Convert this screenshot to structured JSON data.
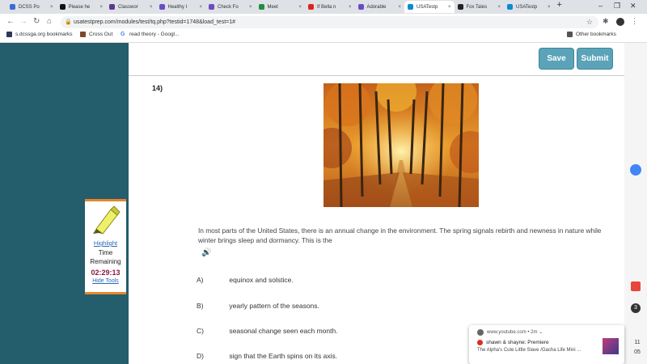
{
  "browser": {
    "tabs": [
      {
        "label": "DCSS Po",
        "color": "#3b6bd6"
      },
      {
        "label": "Please he",
        "color": "#111111"
      },
      {
        "label": "Classwor",
        "color": "#5b3a8c"
      },
      {
        "label": "Healthy I",
        "color": "#6b4cc2"
      },
      {
        "label": "Check Fo",
        "color": "#6b4cc2"
      },
      {
        "label": "Meet",
        "color": "#1e8e3e"
      },
      {
        "label": "If Bella n",
        "color": "#e02020"
      },
      {
        "label": "Adorable",
        "color": "#6b4cc2"
      },
      {
        "label": "USATestp",
        "color": "#0a8bd6"
      },
      {
        "label": "Fox Tales",
        "color": "#222222"
      },
      {
        "label": "USATestp",
        "color": "#0a8bd6"
      }
    ],
    "new_tab": "+",
    "url": "usatestprep.com/modules/test/tq.php?testid=1748&load_test=1#",
    "bookmarks": [
      {
        "label": "s.dcssga.org bookmarks",
        "color": "#2a3a5a"
      },
      {
        "label": "Cross Out",
        "color": "#7a4a2a"
      },
      {
        "label": "read theory - Googl...",
        "color": "#4285f4"
      }
    ],
    "other_bookmarks": "Other bookmarks"
  },
  "toolbar": {
    "save_label": "Save",
    "submit_label": "Submit"
  },
  "question": {
    "number": "14)",
    "text": "In most parts of the United States, there is an annual change in the environment. The spring signals rebirth and newness in nature while winter brings sleep and dormancy. This is the",
    "options": [
      {
        "letter": "A)",
        "text": "equinox and solstice."
      },
      {
        "letter": "B)",
        "text": "yearly pattern of the seasons."
      },
      {
        "letter": "C)",
        "text": "seasonal change seen each month."
      },
      {
        "letter": "D)",
        "text": "sign that the Earth spins on its axis."
      }
    ]
  },
  "tools": {
    "highlight_label": "Highlight",
    "time_label": "Time Remaining",
    "timer": "02:29:13",
    "hide_label": "Hide Tools"
  },
  "notification": {
    "source": "www.youtube.com",
    "age": "2m",
    "title": "shawn & shayne: Premiere",
    "body": "The Alpha's Cute Little Slave /Gacha Life Mini ..."
  },
  "clock": {
    "hour": "11",
    "minute": "05"
  }
}
